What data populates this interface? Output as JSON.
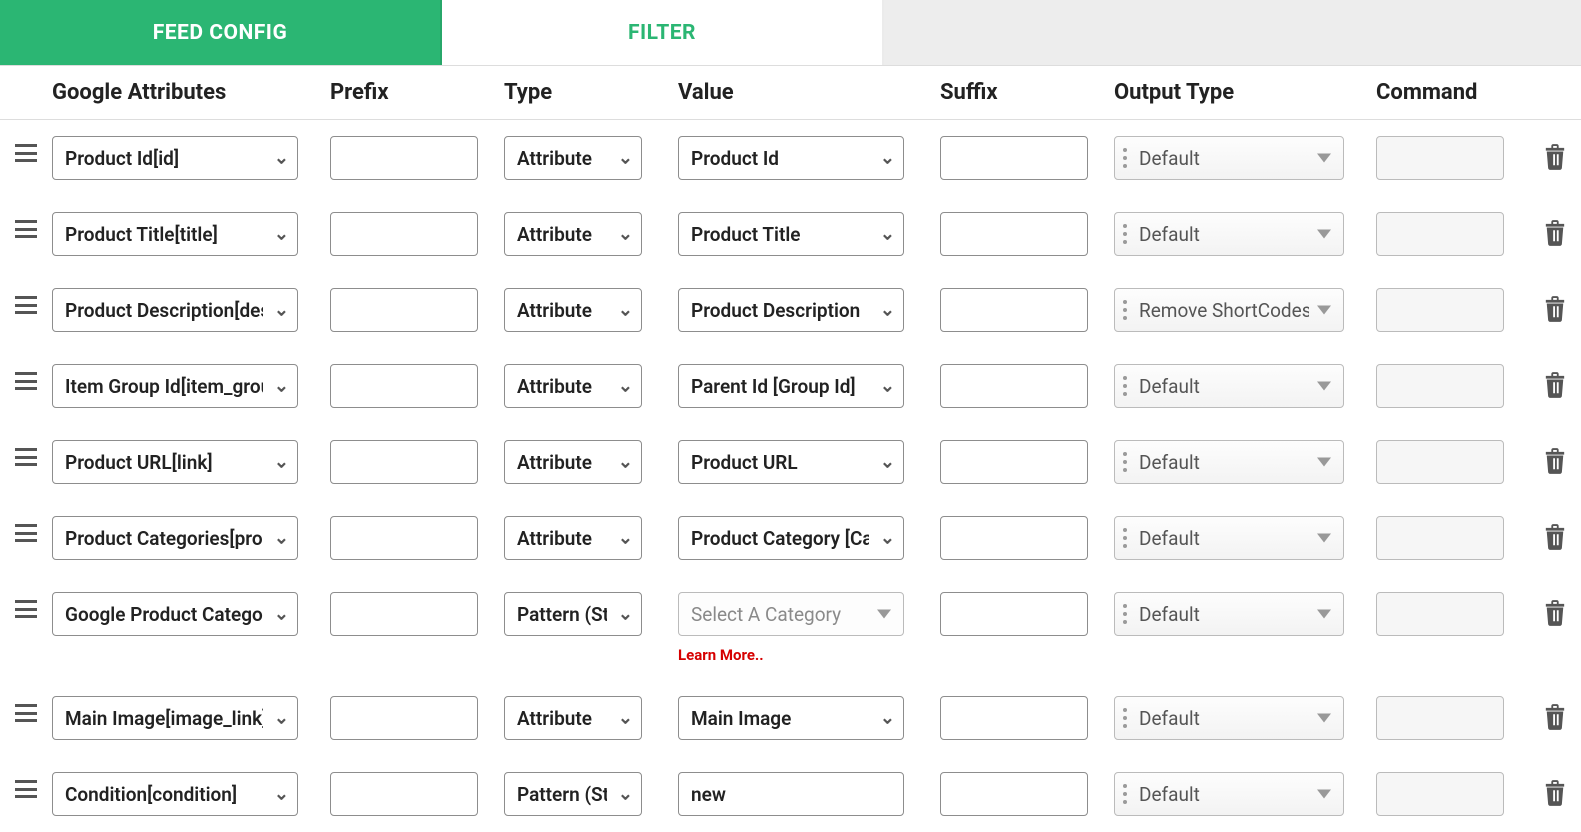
{
  "tabs": {
    "feed_config": "FEED CONFIG",
    "filter": "FILTER"
  },
  "headers": {
    "google_attributes": "Google Attributes",
    "prefix": "Prefix",
    "type": "Type",
    "value": "Value",
    "suffix": "Suffix",
    "output_type": "Output Type",
    "command": "Command"
  },
  "learn_more": "Learn More..",
  "value_placeholder": "Select A Category",
  "rows": [
    {
      "attr": "Product Id[id]",
      "type": "Attribute",
      "value_kind": "select",
      "value": "Product Id",
      "output": "Default"
    },
    {
      "attr": "Product Title[title]",
      "type": "Attribute",
      "value_kind": "select",
      "value": "Product Title",
      "output": "Default"
    },
    {
      "attr": "Product Description[description]",
      "type": "Attribute",
      "value_kind": "select",
      "value": "Product Description",
      "output": "Remove ShortCodes"
    },
    {
      "attr": "Item Group Id[item_group_id]",
      "type": "Attribute",
      "value_kind": "select",
      "value": "Parent Id [Group Id]",
      "output": "Default"
    },
    {
      "attr": "Product URL[link]",
      "type": "Attribute",
      "value_kind": "select",
      "value": "Product URL",
      "output": "Default"
    },
    {
      "attr": "Product Categories[product_type]",
      "type": "Attribute",
      "value_kind": "select",
      "value": "Product Category [Category Path]",
      "output": "Default"
    },
    {
      "attr": "Google Product Category[google_product_category]",
      "type": "Pattern (Static)",
      "value_kind": "placeholder",
      "value": "",
      "output": "Default",
      "learn_more": true
    },
    {
      "attr": "Main Image[image_link]",
      "type": "Attribute",
      "value_kind": "select",
      "value": "Main Image",
      "output": "Default"
    },
    {
      "attr": "Condition[condition]",
      "type": "Pattern (Static)",
      "value_kind": "input",
      "value": "new",
      "output": "Default"
    }
  ]
}
